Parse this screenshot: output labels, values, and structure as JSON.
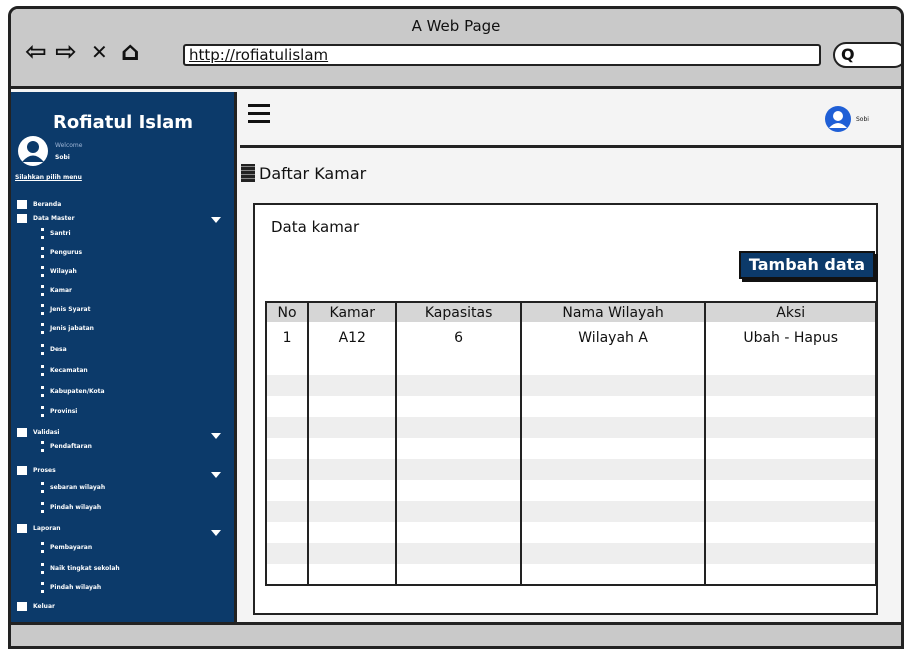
{
  "browser": {
    "title": "A Web Page",
    "url": "http://rofiatulislam",
    "back": "⇦",
    "forward": "⇨",
    "close": "✕",
    "home": "⌂",
    "search_glyph": "Q"
  },
  "sidebar": {
    "brand": "Rofiatul Islam",
    "welcome": "Welcome",
    "user": "Sobi",
    "choose_menu": "Silahkan pilih menu",
    "beranda": "Beranda",
    "data_master": "Data Master",
    "master_items": [
      "Santri",
      "Pengurus",
      "Wilayah",
      "Kamar",
      "Jenis Syarat",
      "Jenis jabatan",
      "Desa",
      "Kecamatan",
      "Kabupaten/Kota",
      "Provinsi"
    ],
    "validasi": "Validasi",
    "validasi_items": [
      "Pendaftaran"
    ],
    "proses": "Proses",
    "proses_items": [
      "sebaran wilayah",
      "Pindah wilayah"
    ],
    "laporan": "Laporan",
    "laporan_items": [
      "Pembayaran",
      "Naik tingkat sekolah",
      "Pindah wilayah"
    ],
    "keluar": "Keluar"
  },
  "header": {
    "user": "Sobi"
  },
  "page": {
    "title": "Daftar Kamar"
  },
  "card": {
    "title": "Data kamar",
    "add_button": "Tambah data",
    "columns": [
      "No",
      "Kamar",
      "Kapasitas",
      "Nama Wilayah",
      "Aksi"
    ],
    "rows": [
      [
        "1",
        "A12",
        "6",
        "Wilayah A",
        "Ubah - Hapus"
      ]
    ]
  },
  "colors": {
    "sidebar": "#0c3a6a",
    "accent": "#0c3a6a"
  }
}
